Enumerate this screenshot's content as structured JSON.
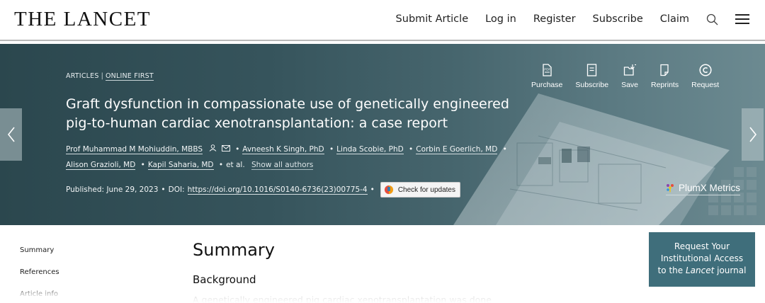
{
  "header": {
    "logo": "THE LANCET",
    "nav": [
      "Submit Article",
      "Log in",
      "Register",
      "Subscribe",
      "Claim"
    ],
    "search_icon": "search-icon",
    "menu_icon": "hamburger-menu-icon"
  },
  "article": {
    "type": "ARTICLES",
    "status": "ONLINE FIRST",
    "title": "Graft dysfunction in compassionate use of genetically engineered pig-to-human cardiac xenotransplantation: a case report",
    "authors": [
      "Prof Muhammad M Mohiuddin, MBBS",
      "Avneesh K Singh, PhD",
      "Linda Scobie, PhD",
      "Corbin E Goerlich, MD",
      "Alison Grazioli, MD",
      "Kapil Saharia, MD"
    ],
    "et_al": "et al.",
    "show_all": "Show all authors",
    "published_label": "Published:",
    "published_date": "June 29, 2023",
    "doi_label": "DOI:",
    "doi": "https://doi.org/10.1016/S0140-6736(23)00775-4",
    "check_updates": "Check for updates"
  },
  "actions": [
    {
      "label": "Purchase",
      "icon": "pdf-icon"
    },
    {
      "label": "Subscribe",
      "icon": "document-icon"
    },
    {
      "label": "Save",
      "icon": "folder-save-icon"
    },
    {
      "label": "Reprints",
      "icon": "reprints-icon"
    },
    {
      "label": "Request",
      "icon": "copyright-icon"
    }
  ],
  "plumx": "PlumX Metrics",
  "toc": [
    "Summary",
    "References",
    "Article info"
  ],
  "content": {
    "summary_heading": "Summary",
    "background_heading": "Background",
    "body_snippet": "A genetically engineered pig cardiac xenotransplantation was done"
  },
  "access_box": {
    "line1": "Request Your",
    "line2": "Institutional Access",
    "line3_prefix": "to the ",
    "line3_italic": "Lancet",
    "line3_suffix": " journal"
  },
  "colors": {
    "hero_dark": "#2b474e",
    "hero_light": "#6c8a91",
    "access_box": "#3f6e7b"
  }
}
